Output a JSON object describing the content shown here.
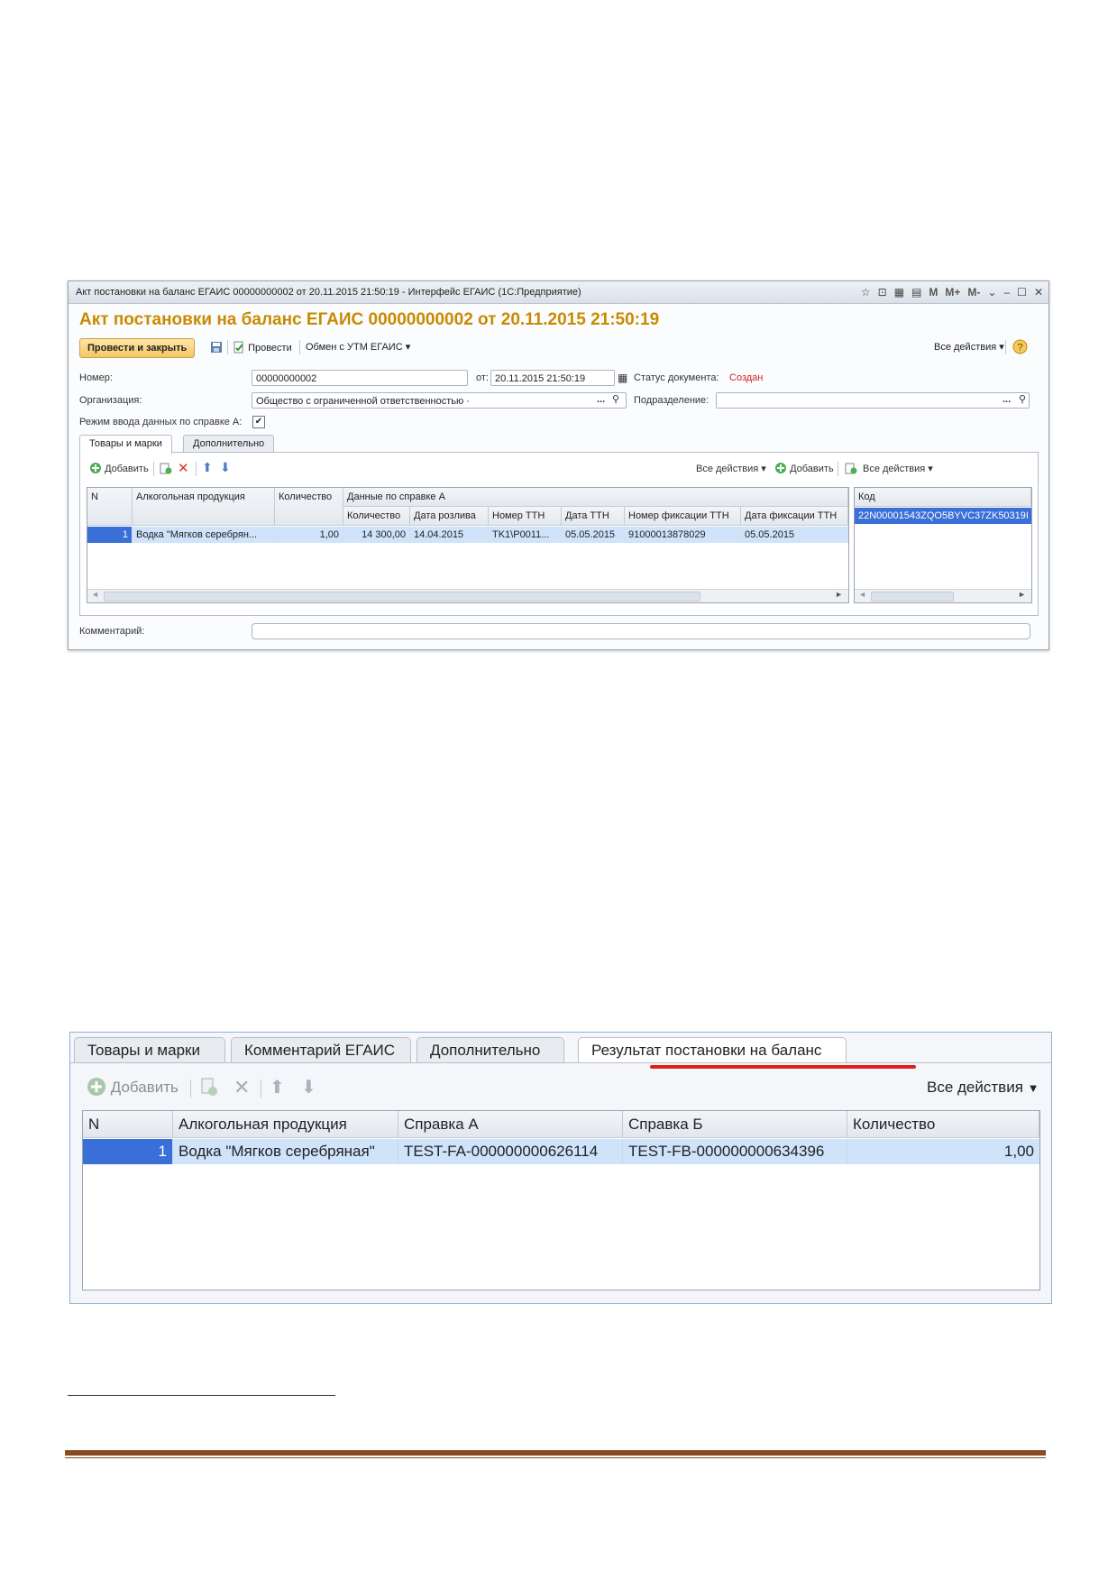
{
  "window1": {
    "title": "Акт постановки на баланс ЕГАИС 00000000002 от 20.11.2015 21:50:19 - Интерфейс ЕГАИС  (1С:Предприятие)",
    "doc_title": "Акт постановки на баланс ЕГАИС 00000000002 от 20.11.2015 21:50:19",
    "title_icons": [
      "star-icon",
      "bookmark-icon",
      "calculator-icon",
      "calendar-icon"
    ],
    "title_mem": [
      "M",
      "M+",
      "M-"
    ],
    "toolbar": {
      "post_close": "Провести и закрыть",
      "post": "Провести",
      "exchange": "Обмен с УТМ ЕГАИС",
      "all_actions": "Все действия"
    },
    "fields": {
      "number_label": "Номер:",
      "number_value": "00000000002",
      "date_label": "от:",
      "date_value": "20.11.2015 21:50:19",
      "status_label": "Статус документа:",
      "status_value": "Создан",
      "org_label": "Организация:",
      "org_value": "Общество с ограниченной ответственностью ·",
      "subdiv_label": "Подразделение:",
      "subdiv_value": "",
      "mode_label": "Режим ввода данных по справке А:",
      "mode_checked": true,
      "comment_label": "Комментарий:",
      "comment_value": ""
    },
    "tabs": [
      "Товары и марки",
      "Дополнительно"
    ],
    "grid_toolbar": {
      "add": "Добавить",
      "all_actions": "Все действия",
      "add_right": "Добавить",
      "all_actions_right": "Все действия"
    },
    "grid": {
      "headers": {
        "n": "N",
        "product": "Алкогольная продукция",
        "qty": "Количество",
        "group_a": "Данные по справке А",
        "a_qty": "Количество",
        "bottling_date": "Дата розлива",
        "ttn_number": "Номер ТТН",
        "ttn_date": "Дата ТТН",
        "fix_number": "Номер фиксации ТТН",
        "fix_date": "Дата фиксации ТТН"
      },
      "rows": [
        {
          "n": "1",
          "product": "Водка \"Мягков серебрян...",
          "qty": "1,00",
          "a_qty": "14 300,00",
          "bottling_date": "14.04.2015",
          "ttn_number": "TK1\\P0011...",
          "ttn_date": "05.05.2015",
          "fix_number": "91000013878029",
          "fix_date": "05.05.2015"
        }
      ]
    },
    "code_grid": {
      "header": "Код",
      "rows": [
        "22N00001543ZQO5BYVC37ZK50319I"
      ]
    }
  },
  "window2": {
    "tabs": [
      "Товары и марки",
      "Комментарий ЕГАИС",
      "Дополнительно",
      "Результат постановки на баланс"
    ],
    "active_tab": "Результат постановки на баланс",
    "toolbar": {
      "add": "Добавить",
      "all_actions": "Все действия"
    },
    "grid": {
      "headers": [
        "N",
        "Алкогольная продукция",
        "Справка А",
        "Справка Б",
        "Количество"
      ],
      "rows": [
        [
          "1",
          "Водка \"Мягков серебряная\"",
          "TEST-FA-000000000626114",
          "TEST-FB-000000000634396",
          "1,00"
        ]
      ]
    }
  },
  "colors": {
    "doc_title": "#c98a00",
    "status": "#d02020",
    "selection": "#cfe3fb",
    "red_underline": "#e01f1f",
    "footer_line": "#8a4a22"
  }
}
